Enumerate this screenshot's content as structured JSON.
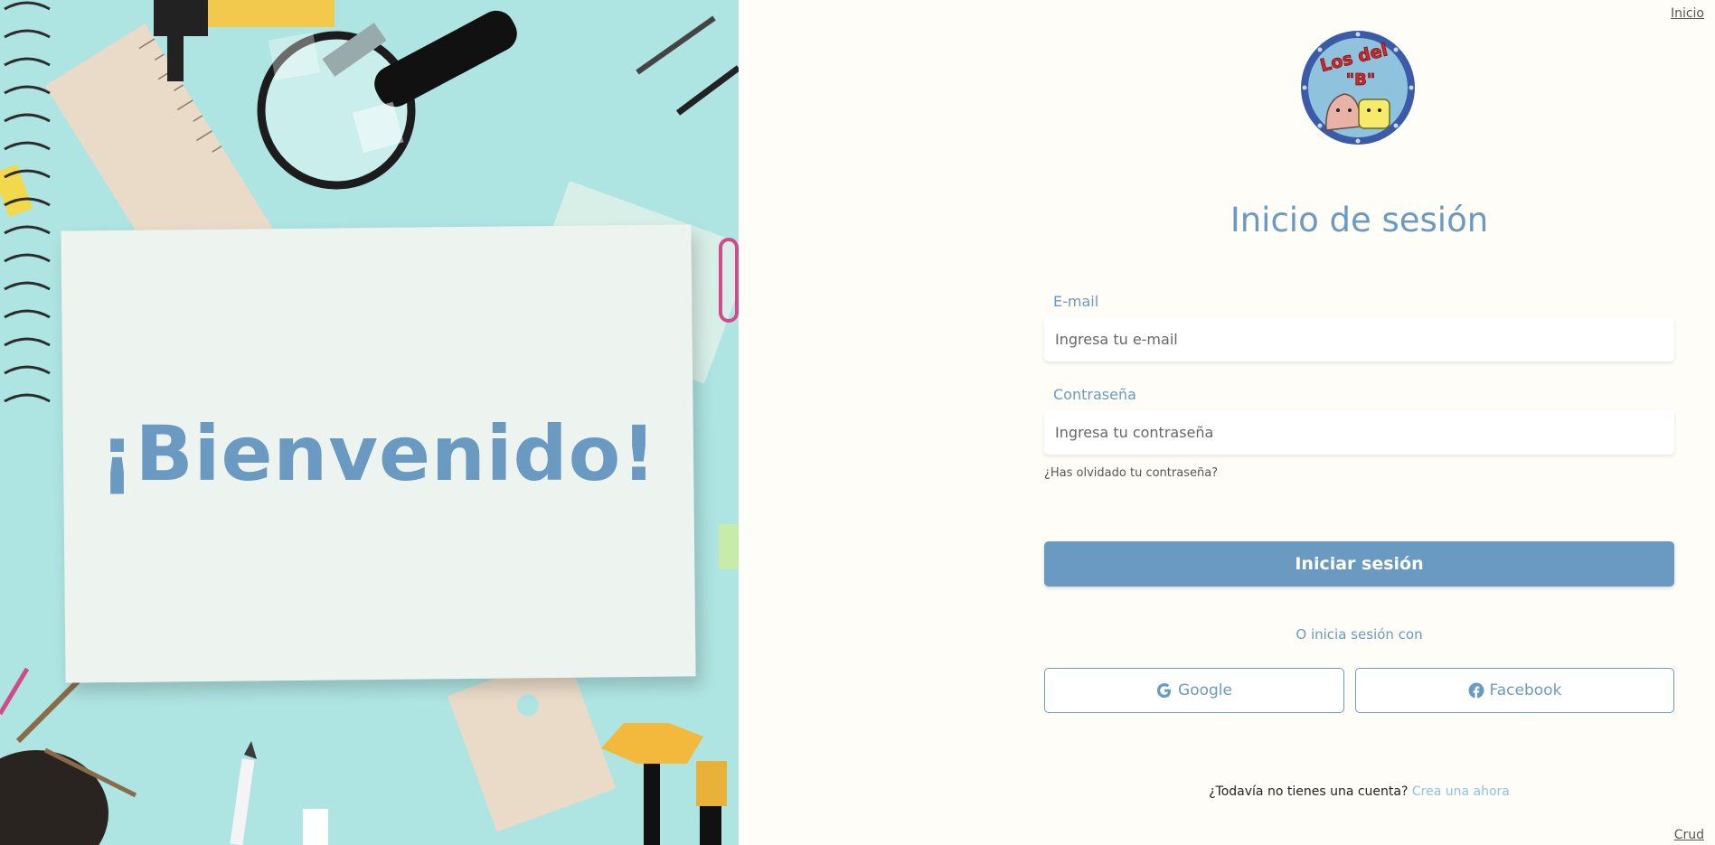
{
  "hero": {
    "welcome_text": "¡Bienvenido!"
  },
  "nav": {
    "top_link": "Inicio",
    "bottom_link": "Crud"
  },
  "logo": {
    "text_line1": "Los del",
    "text_line2": "\"B\""
  },
  "login": {
    "title": "Inicio de sesión",
    "email_label": "E-mail",
    "email_placeholder": "Ingresa tu e-mail",
    "password_label": "Contraseña",
    "password_placeholder": "Ingresa tu contraseña",
    "forgot_link": "¿Has olvidado tu contraseña?",
    "submit_label": "Iniciar sesión",
    "alt_text": "O inicia sesión con",
    "google_label": "Google",
    "facebook_label": "Facebook",
    "signup_prompt": "¿Todavía no tienes una cuenta?",
    "signup_link": "Crea una ahora"
  },
  "colors": {
    "accent": "#6a9ac2",
    "background": "#fffdf7",
    "hero_background": "#aee4e1",
    "link_light": "#8cc4df"
  },
  "icons": [
    "google-icon",
    "facebook-icon"
  ]
}
